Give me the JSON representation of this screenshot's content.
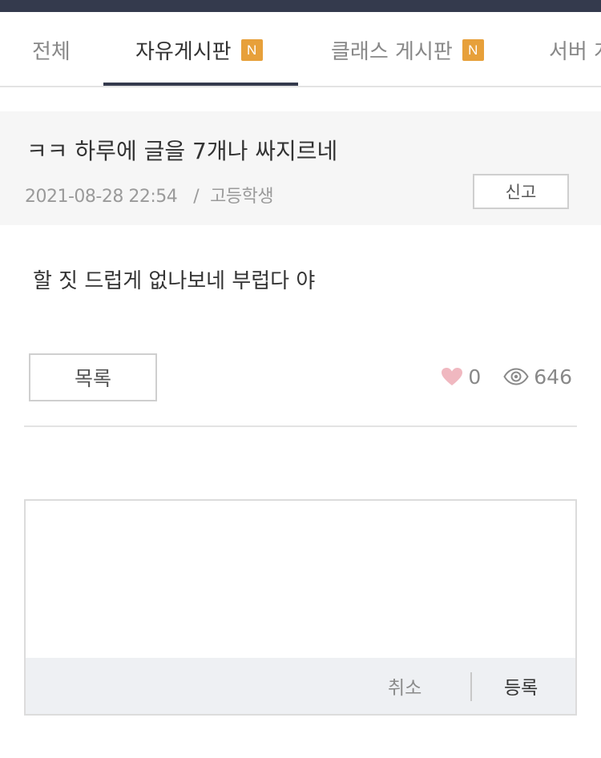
{
  "tabs": [
    {
      "label": "전체",
      "badge": ""
    },
    {
      "label": "자유게시판",
      "badge": "N"
    },
    {
      "label": "클래스 게시판",
      "badge": "N"
    },
    {
      "label": "서버 게",
      "badge": ""
    }
  ],
  "active_tab": "자유게시판",
  "post": {
    "title": "ㅋㅋ 하루에 글을 7개나 싸지르네",
    "date": "2021-08-28 22:54",
    "separator": "/",
    "author": "고등학생",
    "report_label": "신고",
    "body": "할 짓 드럽게 없나보네 부럽다 야"
  },
  "actions": {
    "list_label": "목록"
  },
  "stats": {
    "likes": "0",
    "views": "646",
    "like_icon": "heart-icon",
    "view_icon": "eye-icon"
  },
  "comment": {
    "placeholder": "",
    "cancel_label": "취소",
    "submit_label": "등록"
  },
  "colors": {
    "topbar": "#343a4d",
    "badge": "#e7a03a",
    "heart": "#f0b8c0"
  }
}
